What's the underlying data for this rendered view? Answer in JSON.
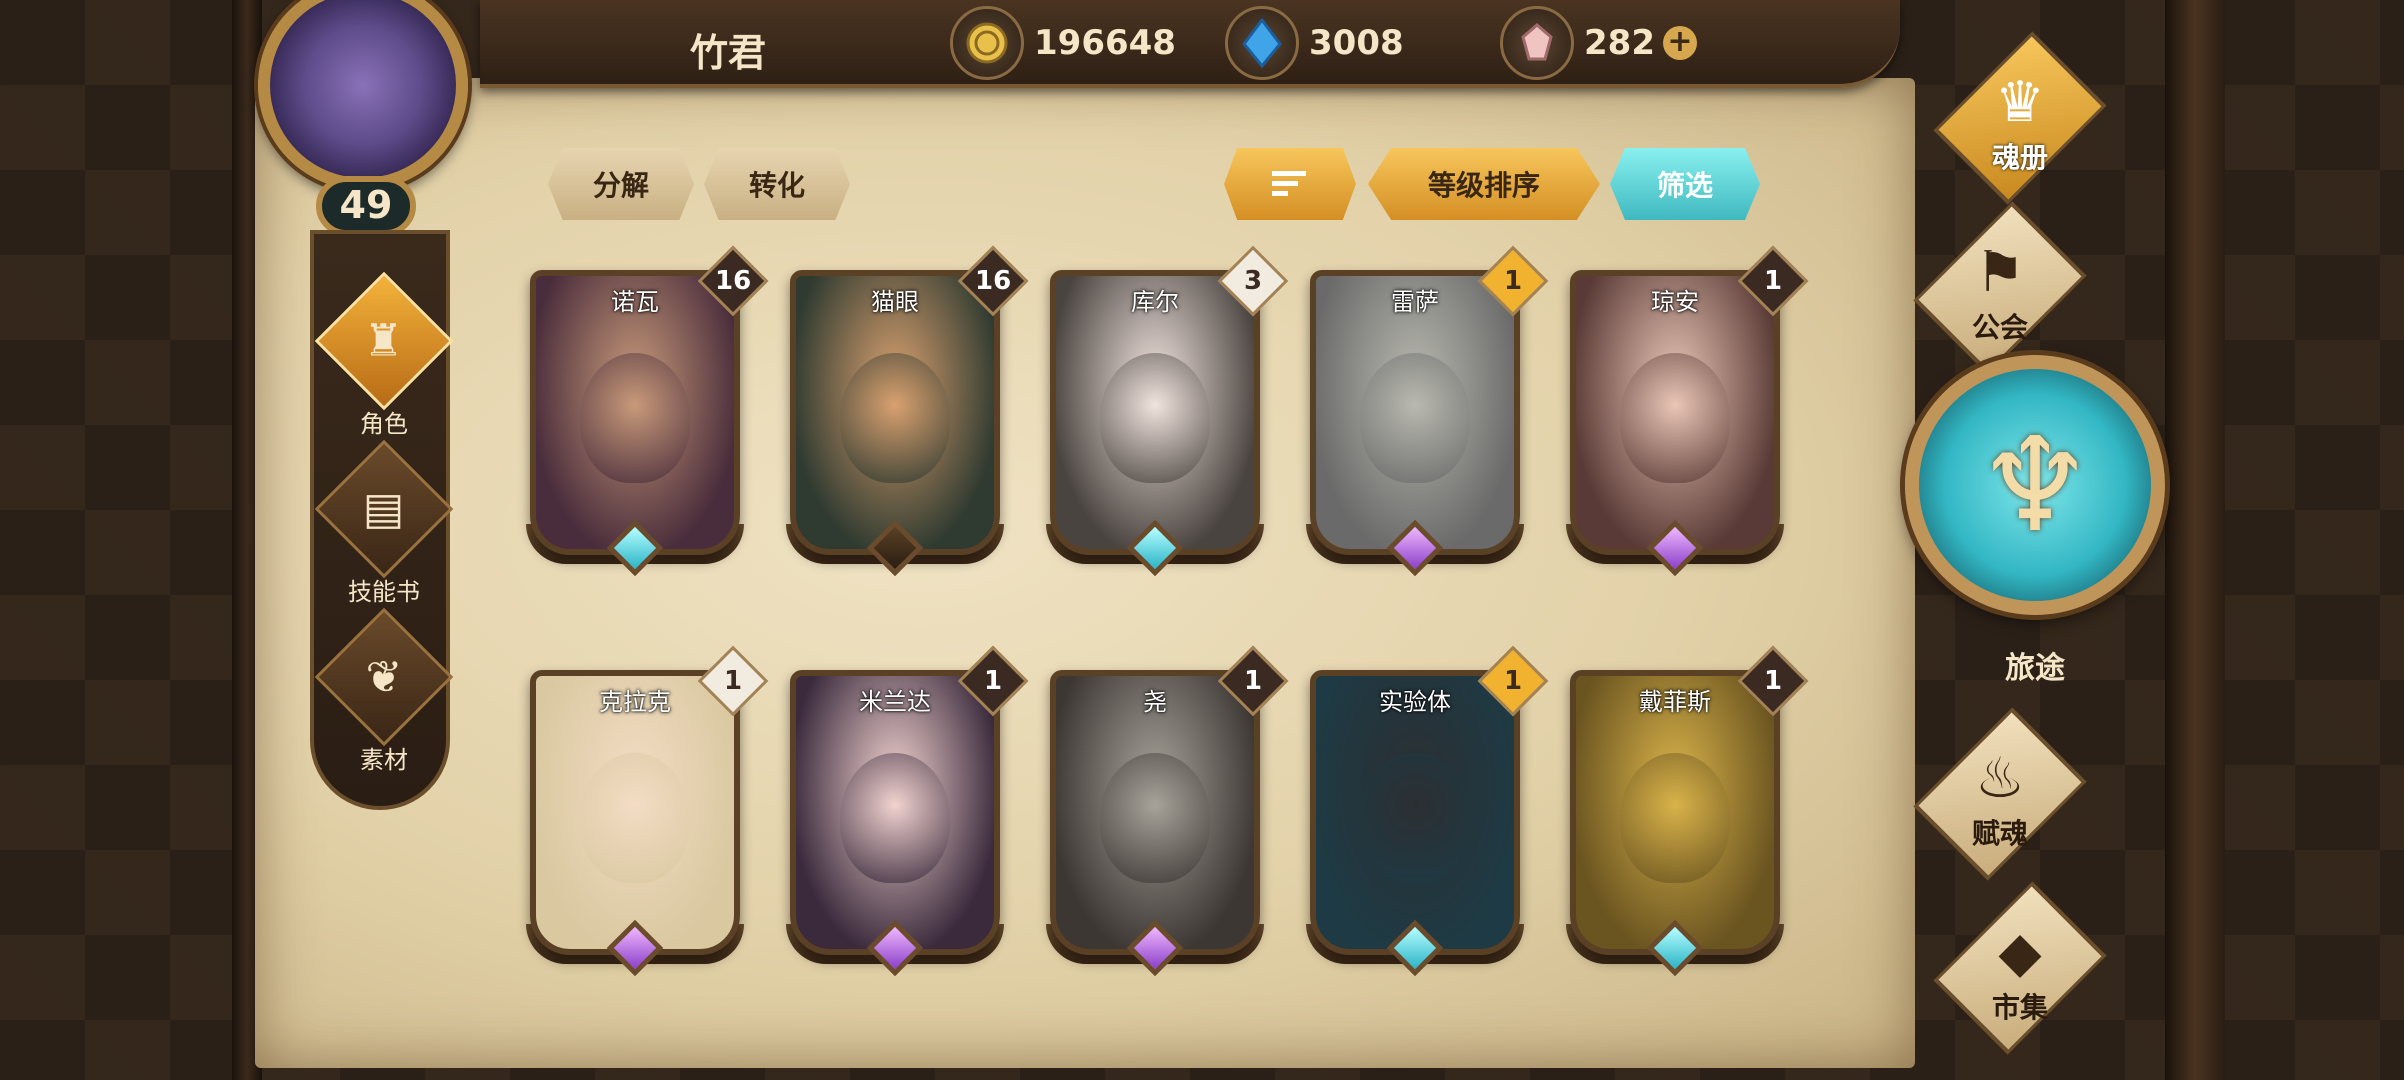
{
  "header": {
    "player_name": "竹君",
    "level": "49",
    "resources": [
      {
        "icon": "gold-coin-icon",
        "value": "196648"
      },
      {
        "icon": "blue-crystal-icon",
        "value": "3008"
      },
      {
        "icon": "pink-gem-icon",
        "value": "282"
      }
    ],
    "add_label": "+"
  },
  "left_nav": {
    "items": [
      {
        "label": "角色",
        "icon": "character-icon",
        "active": true
      },
      {
        "label": "技能书",
        "icon": "skill-book-icon",
        "active": false
      },
      {
        "label": "素材",
        "icon": "material-icon",
        "active": false
      }
    ]
  },
  "toolbar": {
    "decompose": "分解",
    "convert": "转化",
    "sort_order_icon": "sort-icon",
    "sort_level": "等级排序",
    "filter": "筛选"
  },
  "cards": [
    {
      "name": "诺瓦",
      "count": "16",
      "badge": "dark",
      "gem": "teal"
    },
    {
      "name": "猫眼",
      "count": "16",
      "badge": "dark",
      "gem": "dark"
    },
    {
      "name": "库尔",
      "count": "3",
      "badge": "white",
      "gem": "teal"
    },
    {
      "name": "雷萨",
      "count": "1",
      "badge": "gold",
      "gem": "purple"
    },
    {
      "name": "琼安",
      "count": "1",
      "badge": "dark",
      "gem": "purple"
    },
    {
      "name": "克拉克",
      "count": "1",
      "badge": "white",
      "gem": "purple"
    },
    {
      "name": "米兰达",
      "count": "1",
      "badge": "dark",
      "gem": "purple"
    },
    {
      "name": "尧",
      "count": "1",
      "badge": "dark",
      "gem": "purple"
    },
    {
      "name": "实验体",
      "count": "1",
      "badge": "gold",
      "gem": "teal"
    },
    {
      "name": "戴菲斯",
      "count": "1",
      "badge": "dark",
      "gem": "teal"
    }
  ],
  "right_nav": {
    "soul_book": "魂册",
    "guild": "公会",
    "journey": "旅途",
    "soul_grant": "赋魂",
    "market": "市集"
  },
  "colors": {
    "accent_gold": "#f1b32f",
    "accent_teal": "#3fb9c0",
    "parchment": "#e2d1a8"
  }
}
